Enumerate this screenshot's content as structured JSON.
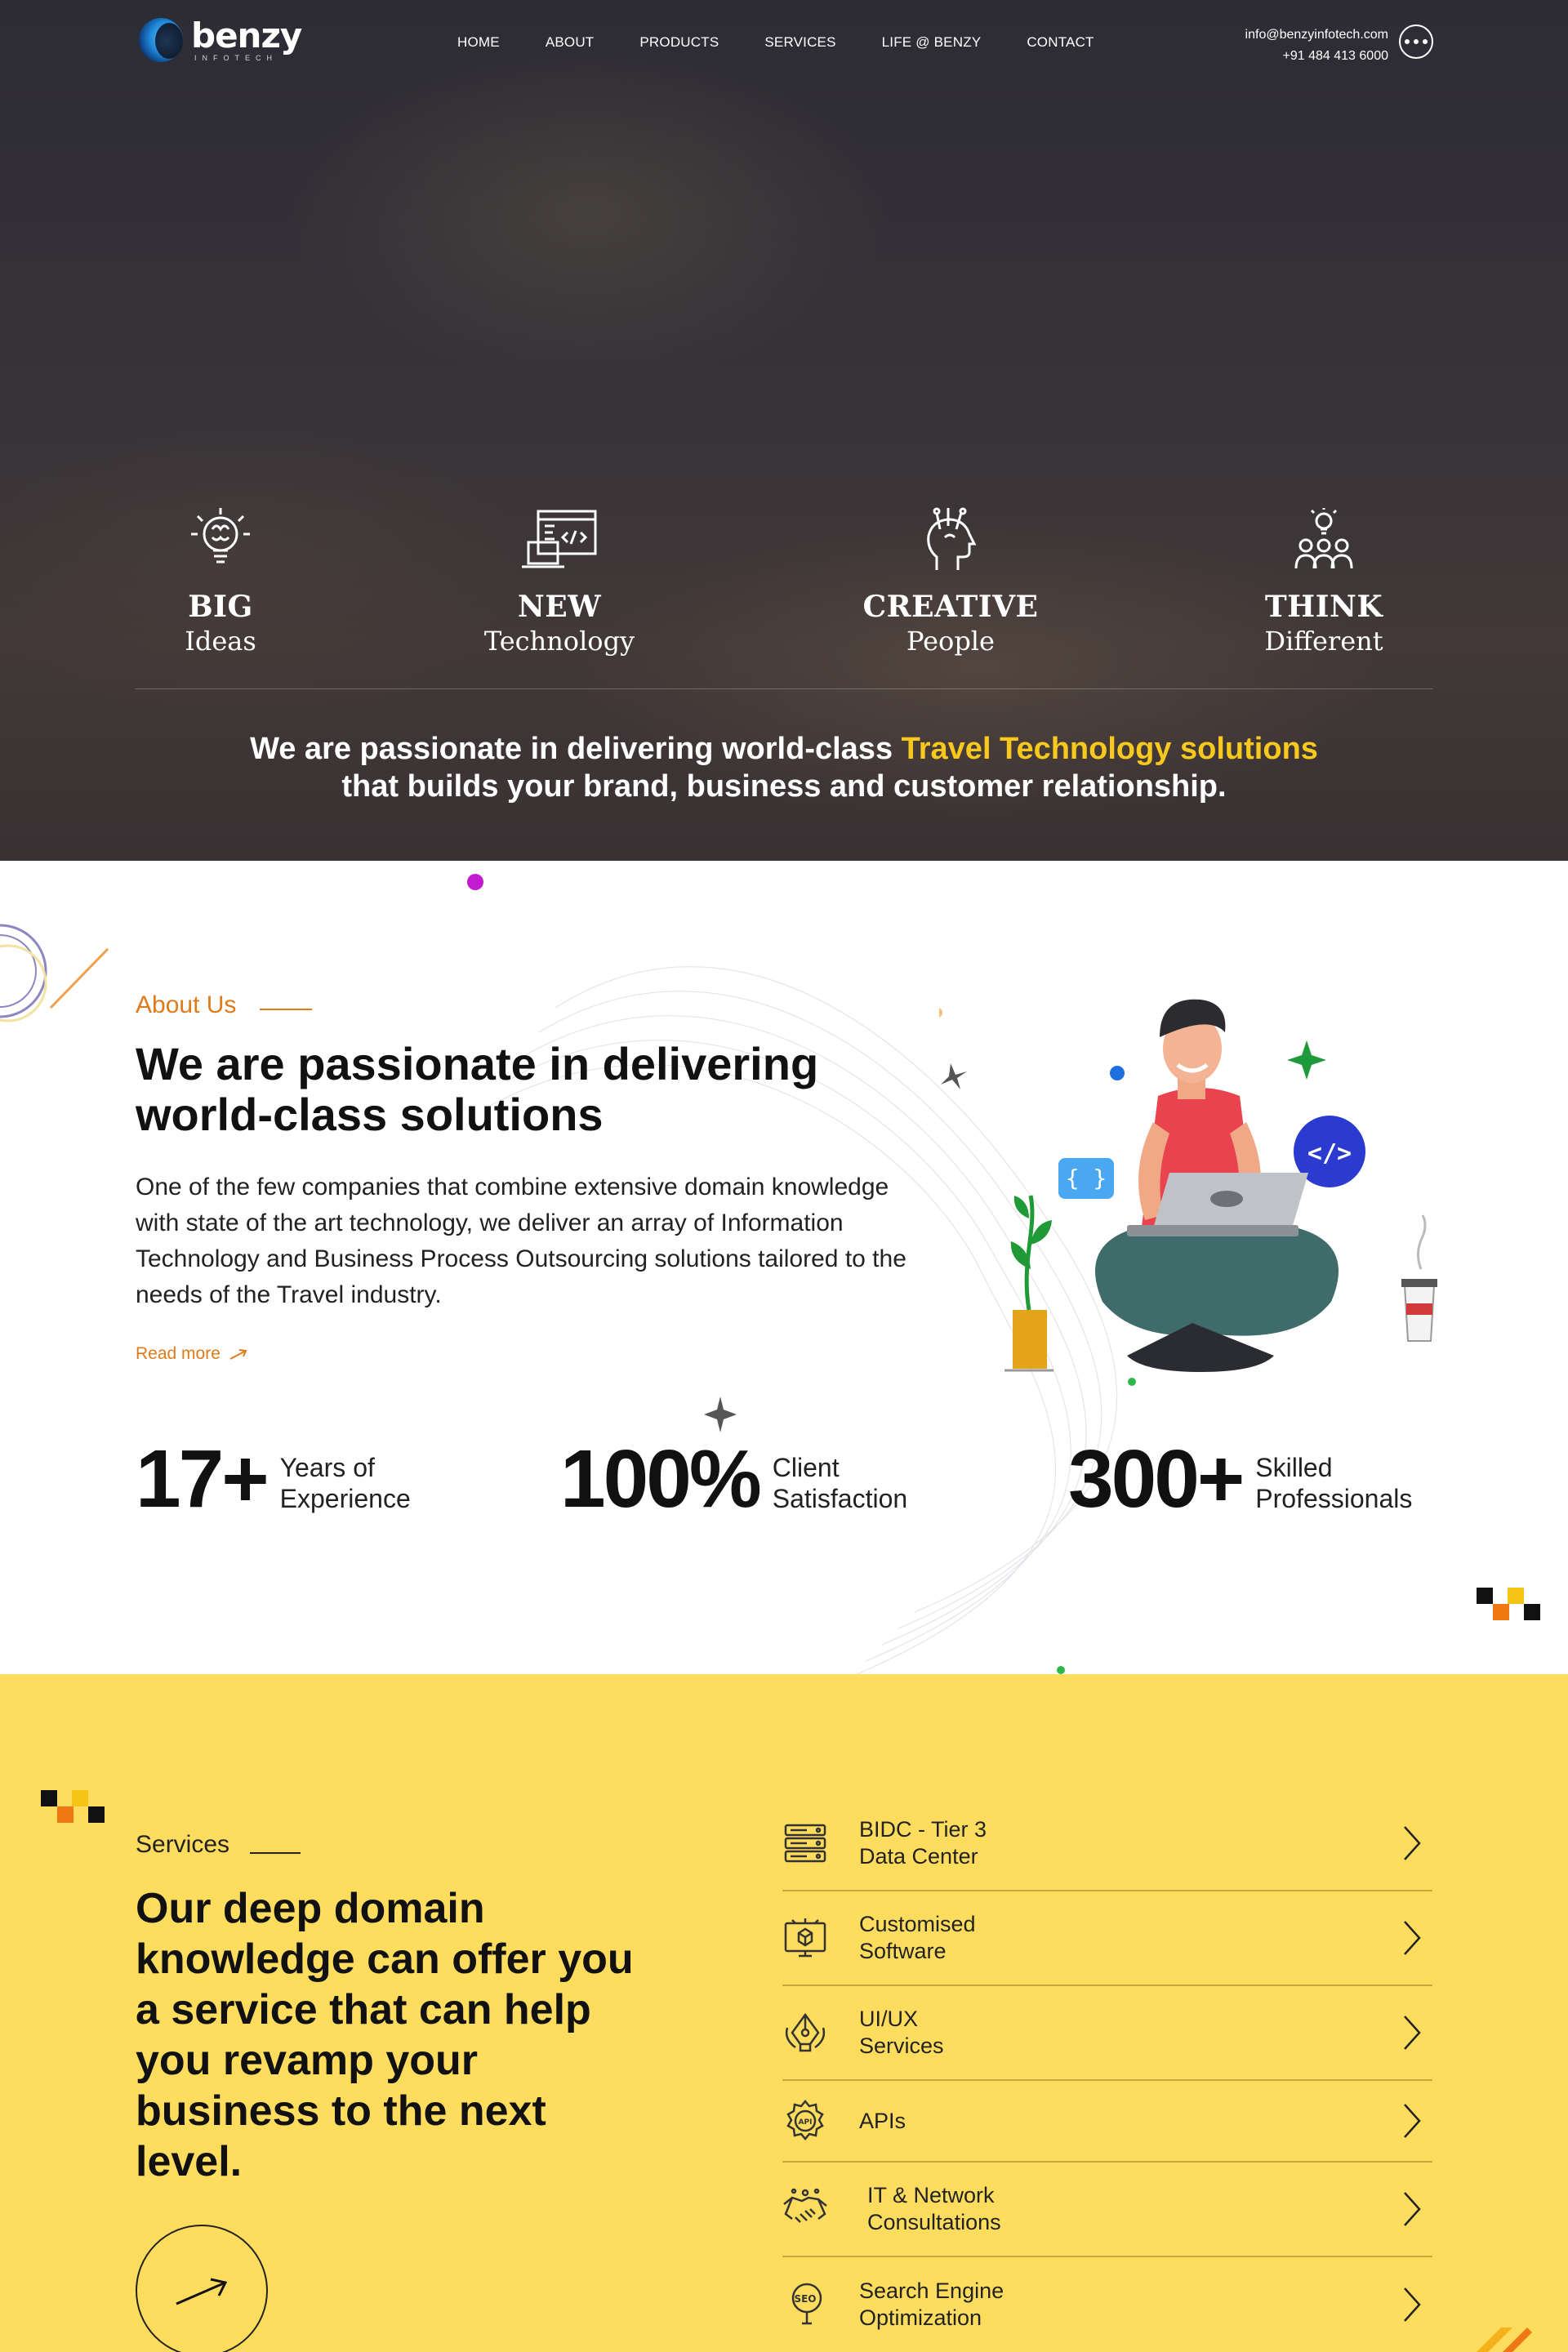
{
  "header": {
    "logo_name": "benzy",
    "logo_sub": "INFOTECH",
    "nav": [
      "HOME",
      "ABOUT",
      "PRODUCTS",
      "SERVICES",
      "LIFE @ BENZY",
      "CONTACT"
    ],
    "email": "info@benzyinfotech.com",
    "phone": "+91 484 413 6000"
  },
  "hero": {
    "features": [
      {
        "icon": "brain-bulb-icon",
        "title": "BIG",
        "subtitle": "Ideas"
      },
      {
        "icon": "code-laptop-icon",
        "title": "NEW",
        "subtitle": "Technology"
      },
      {
        "icon": "creative-head-icon",
        "title": "CREATIVE",
        "subtitle": "People"
      },
      {
        "icon": "team-idea-icon",
        "title": "THINK",
        "subtitle": "Different"
      }
    ],
    "tagline_part1": "We are passionate in delivering world-class ",
    "tagline_highlight": "Travel Technology solutions",
    "tagline_part2": "that builds your brand, business and customer relationship."
  },
  "about": {
    "label": "About Us",
    "title": "We are passionate in delivering world-class solutions",
    "text": "One of the few companies that combine extensive domain knowledge with state of the art technology, we deliver an array of Information Technology and Business Process Outsourcing solutions tailored to the needs of the Travel industry.",
    "read_more": "Read more",
    "stats": [
      {
        "number": "17+",
        "label_line1": "Years of",
        "label_line2": "Experience"
      },
      {
        "number": "100%",
        "label_line1": "Client",
        "label_line2": "Satisfaction"
      },
      {
        "number": "300+",
        "label_line1": "Skilled",
        "label_line2": "Professionals"
      }
    ],
    "illustration_badges": [
      "{ }",
      "</>"
    ]
  },
  "services": {
    "label": "Services",
    "title": "Our deep domain knowledge can offer you a service that can help you revamp your business to the next level.",
    "items": [
      {
        "icon": "server-icon",
        "line1": "BIDC - Tier 3",
        "line2": "Data Center"
      },
      {
        "icon": "monitor-cube-icon",
        "line1": "Customised",
        "line2": "Software"
      },
      {
        "icon": "pen-tool-icon",
        "line1": "UI/UX",
        "line2": "Services"
      },
      {
        "icon": "api-gear-icon",
        "line1": "APIs",
        "line2": ""
      },
      {
        "icon": "handshake-icon",
        "line1": "IT & Network",
        "line2": "Consultations"
      },
      {
        "icon": "seo-search-icon",
        "line1": "Search Engine",
        "line2": "Optimization"
      }
    ]
  },
  "colors": {
    "accent_orange": "#e07a1a",
    "highlight_yellow": "#f7c81d",
    "services_bg": "#fedd5e"
  }
}
